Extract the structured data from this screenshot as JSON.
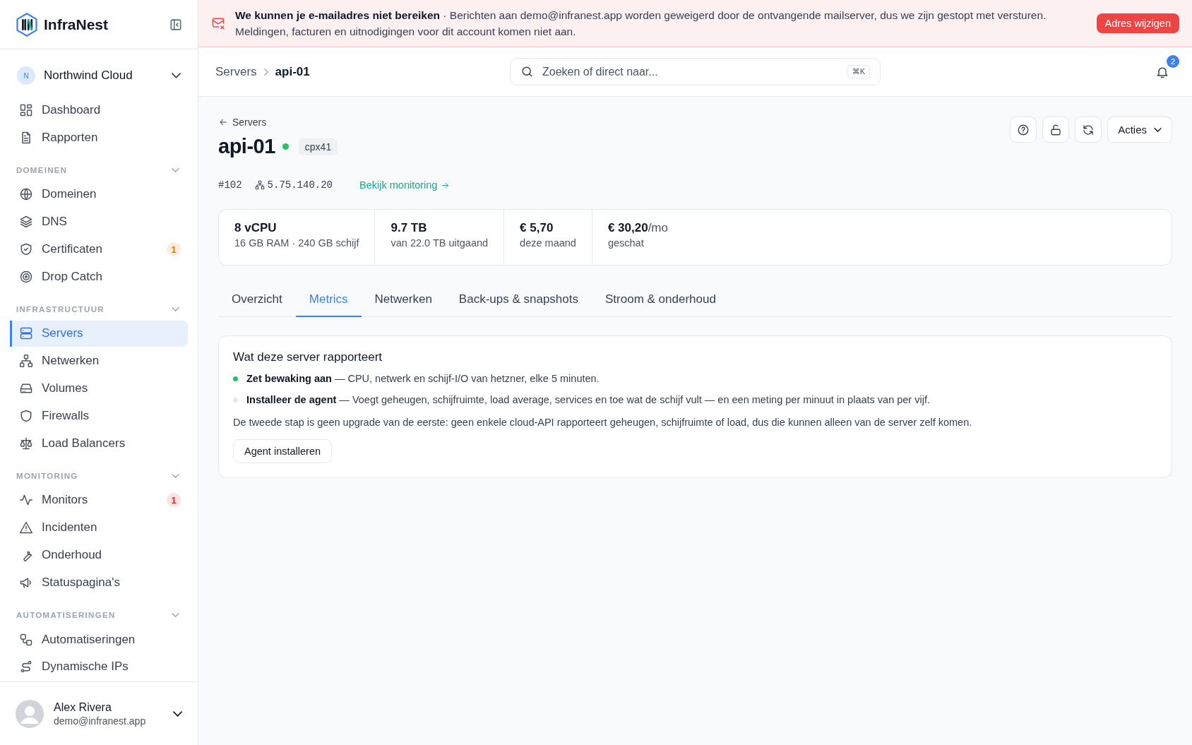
{
  "sidebar": {
    "brand": "InfraNest",
    "workspace": {
      "initial": "N",
      "name": "Northwind Cloud"
    },
    "top_items": [
      {
        "label": "Dashboard",
        "selected": false
      },
      {
        "label": "Rapporten",
        "selected": false
      }
    ],
    "sections": [
      {
        "title": "DOMEINEN",
        "expanded": true,
        "items": [
          {
            "label": "Domeinen",
            "selected": false
          },
          {
            "label": "DNS",
            "selected": false
          },
          {
            "label": "Certificaten",
            "selected": false,
            "badge": "1",
            "color": "#d97706"
          },
          {
            "label": "Drop Catch",
            "selected": false
          }
        ]
      },
      {
        "title": "INFRASTRUCTUUR",
        "expanded": true,
        "items": [
          {
            "label": "Servers",
            "selected": true
          },
          {
            "label": "Netwerken",
            "selected": false
          },
          {
            "label": "Volumes",
            "selected": false
          },
          {
            "label": "Firewalls",
            "selected": false
          },
          {
            "label": "Load Balancers",
            "selected": false
          }
        ]
      },
      {
        "title": "MONITORING",
        "expanded": true,
        "items": [
          {
            "label": "Monitors",
            "selected": false,
            "badge": "1",
            "color": "#dc2626"
          },
          {
            "label": "Incidenten",
            "selected": false
          },
          {
            "label": "Onderhoud",
            "selected": false
          },
          {
            "label": "Statuspagina's",
            "selected": false
          }
        ]
      },
      {
        "title": "AUTOMATISERINGEN",
        "expanded": true,
        "items": [
          {
            "label": "Automatiseringen",
            "selected": false
          },
          {
            "label": "Dynamische IPs",
            "selected": false
          }
        ]
      }
    ],
    "user": {
      "name": "Alex Rivera",
      "email": "demo@infranest.app"
    }
  },
  "banner": {
    "message": "**We kunnen je e-mailadres niet bereiken** · Berichten aan demo@infranest.app worden geweigerd door de ontvangende mailserver, dus we zijn gestopt met versturen. Meldingen, facturen en uitnodigingen voor dit account komen niet aan.",
    "button": "Adres wijzigen"
  },
  "header": {
    "breadcrumbs": [
      "Servers",
      "api-01"
    ],
    "search": {
      "placeholder": "Zoeken of direct naar...",
      "shortcut": "⌘K"
    },
    "notifications": "2"
  },
  "page": {
    "back": "Servers",
    "title": "api-01",
    "online": true,
    "type": "cpx41",
    "id": "#102",
    "ip": "5.75.140.20",
    "link": "Bekijk monitoring",
    "actions": "Acties"
  },
  "stats": [
    {
      "value": "8 vCPU",
      "detail": "16 GB RAM · 240 GB schijf"
    },
    {
      "value": "9.7 TB",
      "detail": "van 22.0 TB uitgaand"
    },
    {
      "value": "€ 5,70",
      "detail": "deze maand"
    },
    {
      "value": "€ 30,20",
      "unit": "/mo",
      "detail": "geschat"
    }
  ],
  "tabs": [
    {
      "label": "Overzicht",
      "selected": false
    },
    {
      "label": "Metrics",
      "selected": true
    },
    {
      "label": "Netwerken",
      "selected": false
    },
    {
      "label": "Back-ups & snapshots",
      "selected": false
    },
    {
      "label": "Stroom & onderhoud",
      "selected": false
    }
  ],
  "card": {
    "title": "Wat deze server rapporteert",
    "steps": [
      {
        "text": "**Zet bewaking aan** — CPU, netwerk en schijf-I/O van hetzner, elke 5 minuten.",
        "done": true
      },
      {
        "text": "**Installeer de agent** — Voegt geheugen, schijfruimte, load average, services en toe wat de schijf vult — en een meting per minuut in plaats van per vijf.",
        "done": false
      }
    ],
    "note": "De tweede stap is geen upgrade van de eerste: geen enkele cloud-API rapporteert geheugen, schijfruimte of load, dus die kunnen alleen van de server zelf komen.",
    "button": "Agent installeren"
  }
}
